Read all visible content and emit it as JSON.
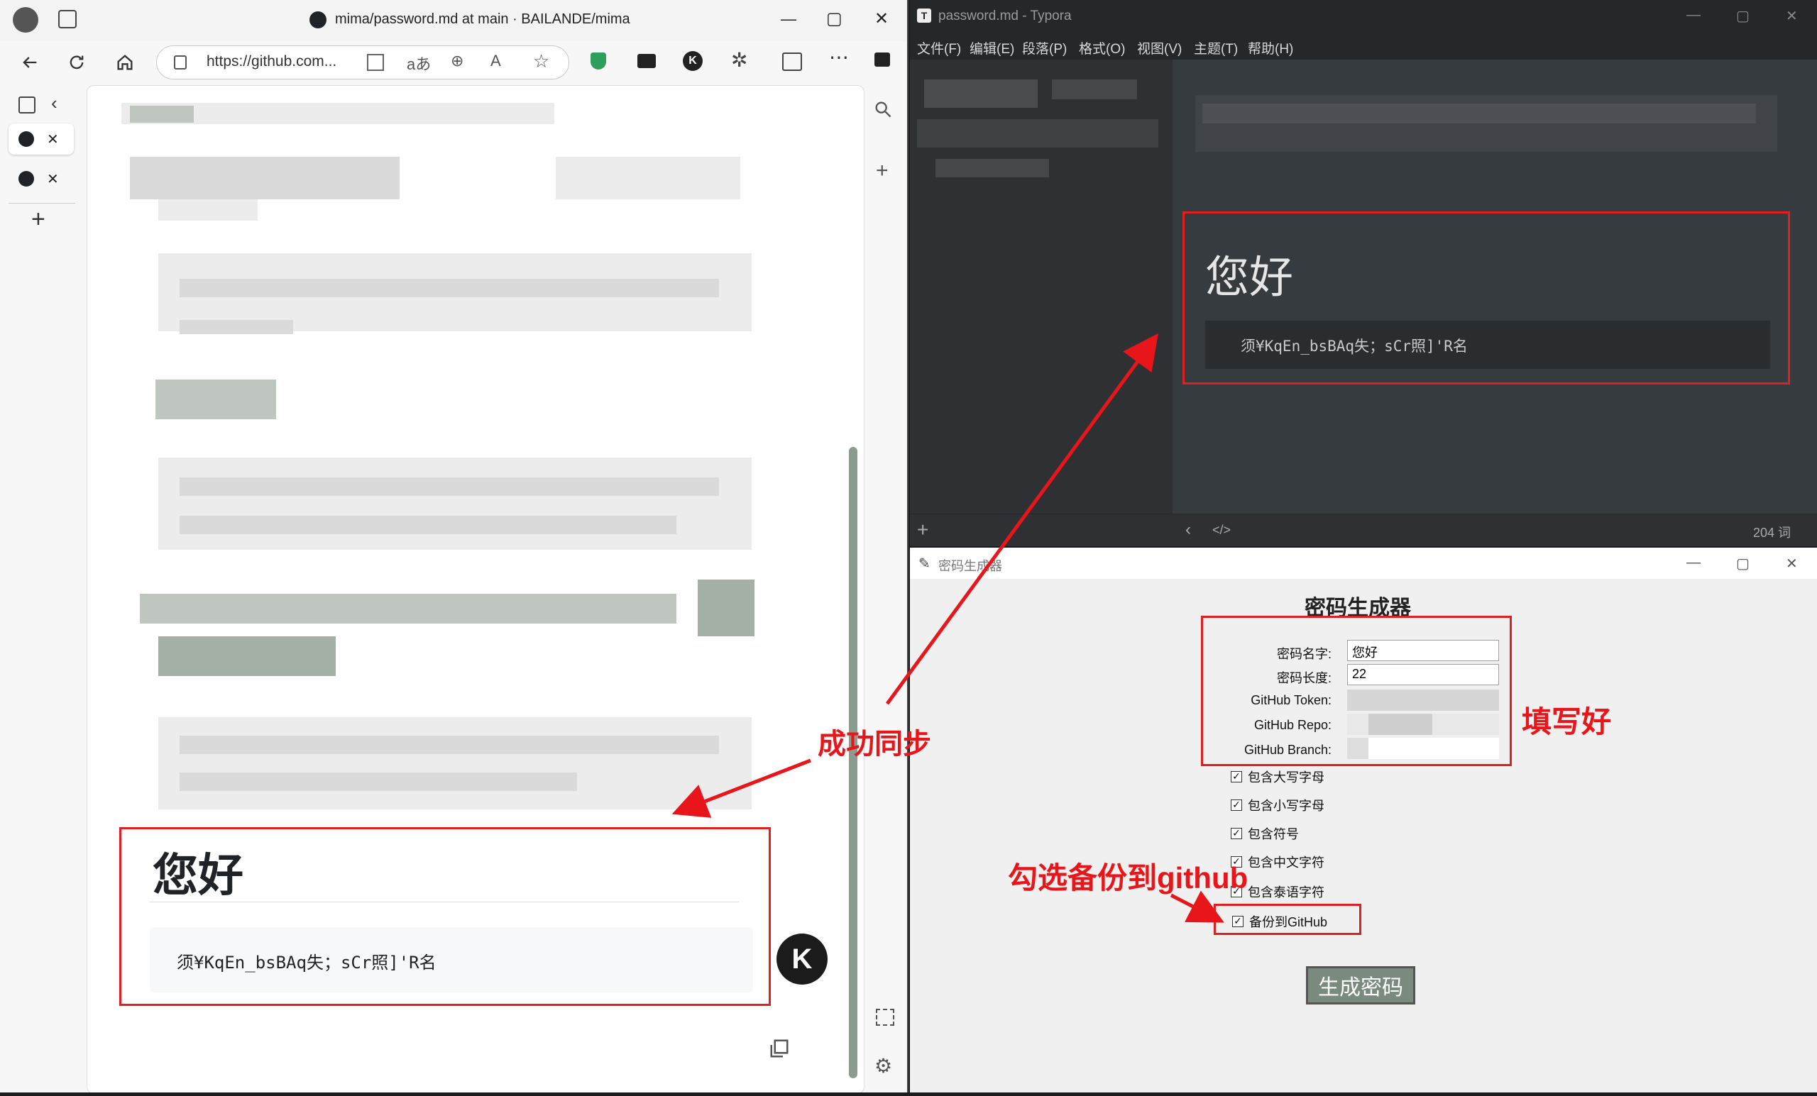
{
  "browser": {
    "tab_title": "mima/password.md at main · BAILANDE/mima",
    "address": "https://github.com...",
    "window_controls": {
      "minimize": "—",
      "maximize": "▢",
      "close": "✕"
    },
    "side_tabs": [
      {
        "icon": "github-icon",
        "close": "✕"
      },
      {
        "icon": "github-icon",
        "close": "✕"
      }
    ],
    "new_tab": "+",
    "content": {
      "heading": "您好",
      "code": "须¥KqEn_bsBAq失；sCr照]'R名"
    }
  },
  "typora": {
    "title": "password.md - Typora",
    "menu": [
      "文件(F)",
      "编辑(E)",
      "段落(P)",
      "格式(O)",
      "视图(V)",
      "主题(T)",
      "帮助(H)"
    ],
    "heading": "您好",
    "code": "须¥KqEn_bsBAq失；sCr照]'R名",
    "word_count": "204 词",
    "add": "+"
  },
  "generator": {
    "title": "密码生成器",
    "heading": "密码生成器",
    "fields": [
      {
        "label": "密码名字:",
        "value": "您好"
      },
      {
        "label": "密码长度:",
        "value": "22"
      },
      {
        "label": "GitHub Token:",
        "value": ""
      },
      {
        "label": "GitHub Repo:",
        "value": ""
      },
      {
        "label": "GitHub Branch:",
        "value": ""
      }
    ],
    "checkboxes": [
      {
        "label": "包含大写字母",
        "checked": true
      },
      {
        "label": "包含小写字母",
        "checked": true
      },
      {
        "label": "包含符号",
        "checked": true
      },
      {
        "label": "包含中文字符",
        "checked": true
      },
      {
        "label": "包含泰语字符",
        "checked": true
      },
      {
        "label": "备份到GitHub",
        "checked": true
      }
    ],
    "button": "生成密码"
  },
  "annotations": {
    "sync": "成功同步",
    "filled": "填写好",
    "backup": "勾选备份到github"
  },
  "colors": {
    "annotation": "#e8161a",
    "generate_button": "#7b8a7e"
  }
}
